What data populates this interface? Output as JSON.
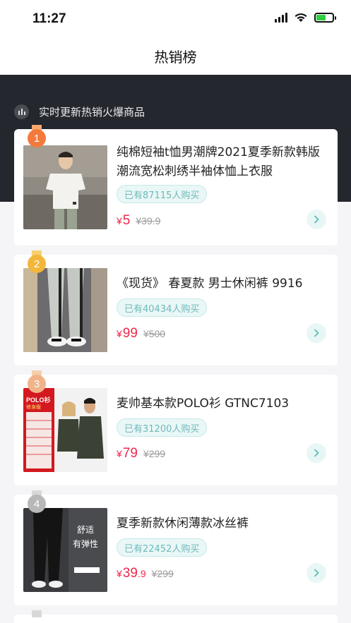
{
  "status_bar": {
    "time": "11:27"
  },
  "navbar": {
    "title": "热销榜"
  },
  "hero": {
    "subtitle": "实时更新热销火爆商品"
  },
  "products": [
    {
      "rank": "1",
      "title": "纯棉短袖t恤男潮牌2021夏季新款韩版潮流宽松刺绣半袖体恤上衣服",
      "sold": "已有87115人购买",
      "price_currency": "¥",
      "price_int": "5",
      "price_dec": "",
      "original_price": "¥39.9",
      "rank_color": "#f47a3c"
    },
    {
      "rank": "2",
      "title": "《现货》 春夏款 男士休闲裤 9916",
      "sold": "已有40434人购买",
      "price_currency": "¥",
      "price_int": "99",
      "price_dec": "",
      "original_price": "¥500",
      "rank_color": "#f2b63a"
    },
    {
      "rank": "3",
      "title": "麦帅基本款POLO衫 GTNC7103",
      "sold": "已有31200人购买",
      "price_currency": "¥",
      "price_int": "79",
      "price_dec": "",
      "original_price": "¥299",
      "rank_color": "#f0b38a"
    },
    {
      "rank": "4",
      "title": "夏季新款休闲薄款冰丝裤",
      "sold": "已有22452人购买",
      "price_currency": "¥",
      "price_int": "39",
      "price_dec": ".9",
      "original_price": "¥299",
      "rank_color": "#b8b8b8",
      "image_text": [
        "舒适",
        "有弹性"
      ]
    }
  ],
  "product3_image_text": {
    "brand": "POLO衫",
    "tag": "修身版"
  },
  "colors": {
    "price": "#f0274a",
    "accent_teal": "#6fb9b9",
    "hero_bg": "#25272e"
  }
}
